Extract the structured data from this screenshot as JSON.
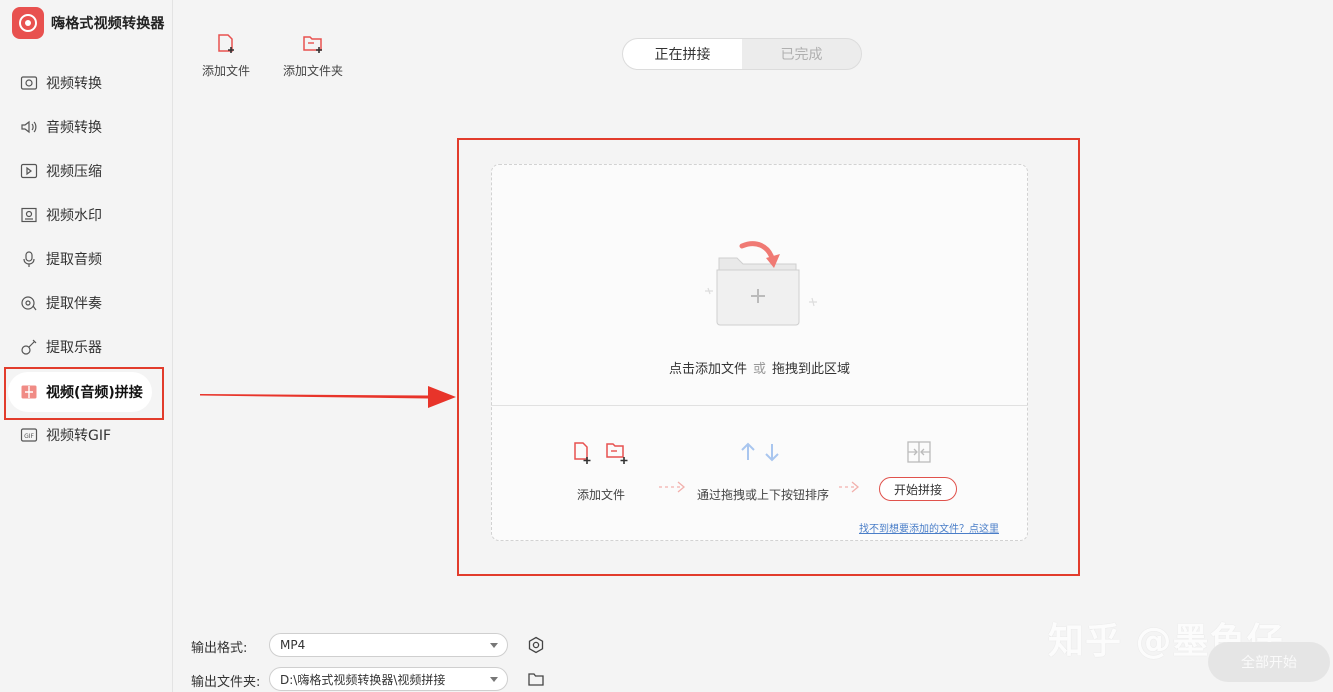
{
  "app": {
    "title": "嗨格式视频转换器"
  },
  "sidebar": {
    "items": [
      {
        "label": "视频转换",
        "icon": "video-convert-icon"
      },
      {
        "label": "音频转换",
        "icon": "audio-convert-icon"
      },
      {
        "label": "视频压缩",
        "icon": "video-compress-icon"
      },
      {
        "label": "视频水印",
        "icon": "video-watermark-icon"
      },
      {
        "label": "提取音频",
        "icon": "extract-audio-icon"
      },
      {
        "label": "提取伴奏",
        "icon": "extract-accompaniment-icon"
      },
      {
        "label": "提取乐器",
        "icon": "guitar-icon"
      },
      {
        "label": "视频(音频)拼接",
        "icon": "merge-icon",
        "active": true
      },
      {
        "label": "视频转GIF",
        "icon": "gif-icon"
      }
    ]
  },
  "toolbar": {
    "add_file": "添加文件",
    "add_folder": "添加文件夹"
  },
  "tabs": {
    "in_progress": "正在拼接",
    "done": "已完成"
  },
  "dropzone": {
    "prompt_click": "点击添加文件",
    "prompt_or": "或",
    "prompt_drag": "拖拽到此区域",
    "step1": "添加文件",
    "step2": "通过拖拽或上下按钮排序",
    "start_button": "开始拼接",
    "help_link": "找不到想要添加的文件？点这里"
  },
  "output": {
    "format_label": "输出格式:",
    "format_value": "MP4",
    "folder_label": "输出文件夹:",
    "folder_value": "D:\\嗨格式视频转换器\\视频拼接"
  },
  "start_all": "全部开始",
  "watermark": "知乎 @墨鱼仔",
  "colors": {
    "accent": "#e8514f",
    "annotation": "#e23c2c"
  }
}
